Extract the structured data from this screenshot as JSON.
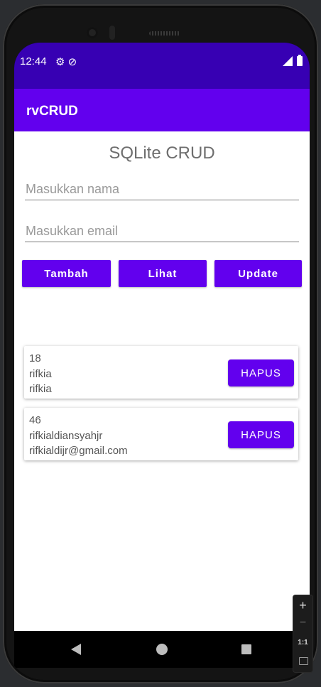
{
  "status_bar": {
    "time": "12:44",
    "left_icons": "⚙ ⊘"
  },
  "app_bar": {
    "title": "rvCRUD"
  },
  "main": {
    "heading": "SQLite CRUD",
    "name_placeholder": "Masukkan nama",
    "email_placeholder": "Masukkan email",
    "buttons": {
      "add": "Tambah",
      "view": "Lihat",
      "update": "Update"
    }
  },
  "records": [
    {
      "id": "18",
      "name": "rifkia",
      "email": "rifkia",
      "delete_label": "HAPUS"
    },
    {
      "id": "46",
      "name": "rifkialdiansyahjr",
      "email": "rifkialdijr@gmail.com",
      "delete_label": "HAPUS"
    }
  ],
  "emulator_zoom": {
    "zoom_in": "+",
    "zoom_out": "−",
    "ratio": "1:1"
  },
  "colors": {
    "primary": "#6200ee",
    "primary_dark": "#3700b3"
  },
  "icons": [
    "settings-icon",
    "do-not-disturb-icon",
    "signal-icon",
    "battery-icon",
    "nav-back-icon",
    "nav-home-icon",
    "nav-recents-icon"
  ]
}
